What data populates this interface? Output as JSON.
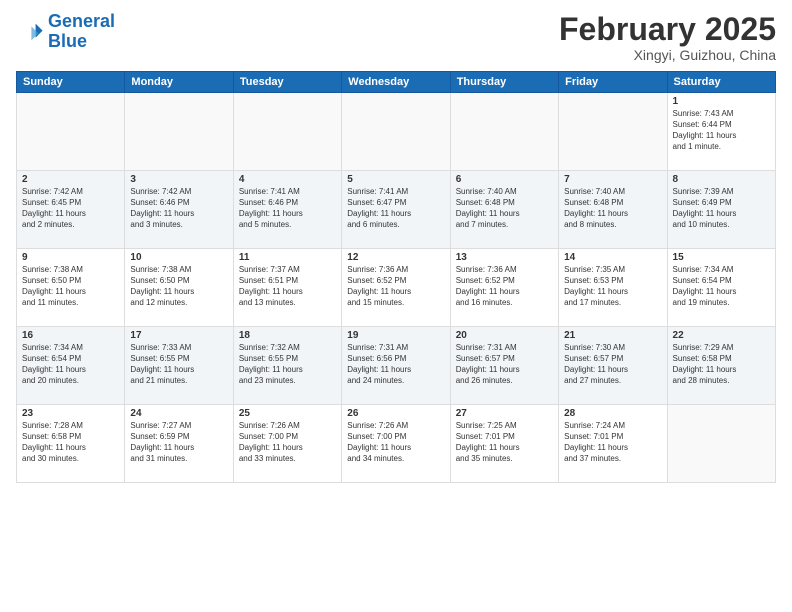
{
  "header": {
    "logo_line1": "General",
    "logo_line2": "Blue",
    "month_title": "February 2025",
    "location": "Xingyi, Guizhou, China"
  },
  "weekdays": [
    "Sunday",
    "Monday",
    "Tuesday",
    "Wednesday",
    "Thursday",
    "Friday",
    "Saturday"
  ],
  "weeks": [
    [
      {
        "day": "",
        "info": ""
      },
      {
        "day": "",
        "info": ""
      },
      {
        "day": "",
        "info": ""
      },
      {
        "day": "",
        "info": ""
      },
      {
        "day": "",
        "info": ""
      },
      {
        "day": "",
        "info": ""
      },
      {
        "day": "1",
        "info": "Sunrise: 7:43 AM\nSunset: 6:44 PM\nDaylight: 11 hours\nand 1 minute."
      }
    ],
    [
      {
        "day": "2",
        "info": "Sunrise: 7:42 AM\nSunset: 6:45 PM\nDaylight: 11 hours\nand 2 minutes."
      },
      {
        "day": "3",
        "info": "Sunrise: 7:42 AM\nSunset: 6:46 PM\nDaylight: 11 hours\nand 3 minutes."
      },
      {
        "day": "4",
        "info": "Sunrise: 7:41 AM\nSunset: 6:46 PM\nDaylight: 11 hours\nand 5 minutes."
      },
      {
        "day": "5",
        "info": "Sunrise: 7:41 AM\nSunset: 6:47 PM\nDaylight: 11 hours\nand 6 minutes."
      },
      {
        "day": "6",
        "info": "Sunrise: 7:40 AM\nSunset: 6:48 PM\nDaylight: 11 hours\nand 7 minutes."
      },
      {
        "day": "7",
        "info": "Sunrise: 7:40 AM\nSunset: 6:48 PM\nDaylight: 11 hours\nand 8 minutes."
      },
      {
        "day": "8",
        "info": "Sunrise: 7:39 AM\nSunset: 6:49 PM\nDaylight: 11 hours\nand 10 minutes."
      }
    ],
    [
      {
        "day": "9",
        "info": "Sunrise: 7:38 AM\nSunset: 6:50 PM\nDaylight: 11 hours\nand 11 minutes."
      },
      {
        "day": "10",
        "info": "Sunrise: 7:38 AM\nSunset: 6:50 PM\nDaylight: 11 hours\nand 12 minutes."
      },
      {
        "day": "11",
        "info": "Sunrise: 7:37 AM\nSunset: 6:51 PM\nDaylight: 11 hours\nand 13 minutes."
      },
      {
        "day": "12",
        "info": "Sunrise: 7:36 AM\nSunset: 6:52 PM\nDaylight: 11 hours\nand 15 minutes."
      },
      {
        "day": "13",
        "info": "Sunrise: 7:36 AM\nSunset: 6:52 PM\nDaylight: 11 hours\nand 16 minutes."
      },
      {
        "day": "14",
        "info": "Sunrise: 7:35 AM\nSunset: 6:53 PM\nDaylight: 11 hours\nand 17 minutes."
      },
      {
        "day": "15",
        "info": "Sunrise: 7:34 AM\nSunset: 6:54 PM\nDaylight: 11 hours\nand 19 minutes."
      }
    ],
    [
      {
        "day": "16",
        "info": "Sunrise: 7:34 AM\nSunset: 6:54 PM\nDaylight: 11 hours\nand 20 minutes."
      },
      {
        "day": "17",
        "info": "Sunrise: 7:33 AM\nSunset: 6:55 PM\nDaylight: 11 hours\nand 21 minutes."
      },
      {
        "day": "18",
        "info": "Sunrise: 7:32 AM\nSunset: 6:55 PM\nDaylight: 11 hours\nand 23 minutes."
      },
      {
        "day": "19",
        "info": "Sunrise: 7:31 AM\nSunset: 6:56 PM\nDaylight: 11 hours\nand 24 minutes."
      },
      {
        "day": "20",
        "info": "Sunrise: 7:31 AM\nSunset: 6:57 PM\nDaylight: 11 hours\nand 26 minutes."
      },
      {
        "day": "21",
        "info": "Sunrise: 7:30 AM\nSunset: 6:57 PM\nDaylight: 11 hours\nand 27 minutes."
      },
      {
        "day": "22",
        "info": "Sunrise: 7:29 AM\nSunset: 6:58 PM\nDaylight: 11 hours\nand 28 minutes."
      }
    ],
    [
      {
        "day": "23",
        "info": "Sunrise: 7:28 AM\nSunset: 6:58 PM\nDaylight: 11 hours\nand 30 minutes."
      },
      {
        "day": "24",
        "info": "Sunrise: 7:27 AM\nSunset: 6:59 PM\nDaylight: 11 hours\nand 31 minutes."
      },
      {
        "day": "25",
        "info": "Sunrise: 7:26 AM\nSunset: 7:00 PM\nDaylight: 11 hours\nand 33 minutes."
      },
      {
        "day": "26",
        "info": "Sunrise: 7:26 AM\nSunset: 7:00 PM\nDaylight: 11 hours\nand 34 minutes."
      },
      {
        "day": "27",
        "info": "Sunrise: 7:25 AM\nSunset: 7:01 PM\nDaylight: 11 hours\nand 35 minutes."
      },
      {
        "day": "28",
        "info": "Sunrise: 7:24 AM\nSunset: 7:01 PM\nDaylight: 11 hours\nand 37 minutes."
      },
      {
        "day": "",
        "info": ""
      }
    ]
  ]
}
